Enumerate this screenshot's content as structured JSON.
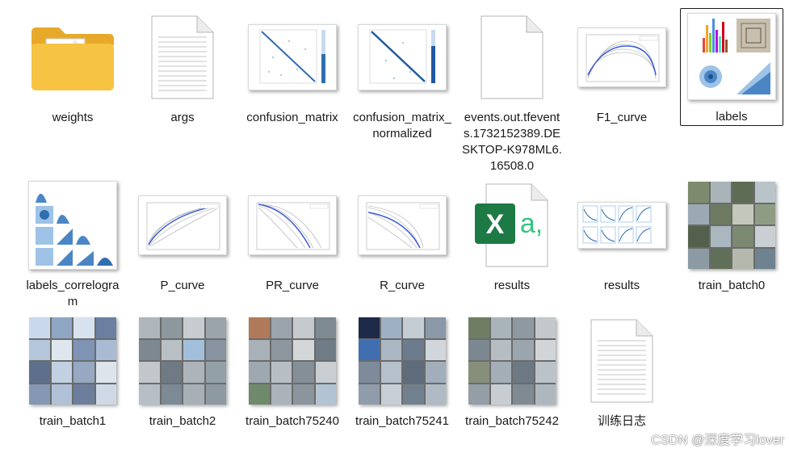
{
  "files": [
    {
      "name": "weights",
      "icon": "folder-icon"
    },
    {
      "name": "args",
      "icon": "text-file-icon"
    },
    {
      "name": "confusion_matrix",
      "icon": "image-thumbnail-icon"
    },
    {
      "name": "confusion_matrix_normalized",
      "icon": "image-thumbnail-icon"
    },
    {
      "name": "events.out.tfevents.1732152389.DESKTOP-K978ML6.16508.0",
      "icon": "blank-file-icon"
    },
    {
      "name": "F1_curve",
      "icon": "image-thumbnail-icon"
    },
    {
      "name": "labels",
      "icon": "image-thumbnail-icon",
      "selected": true
    },
    {
      "name": "labels_correlogram",
      "icon": "image-thumbnail-icon"
    },
    {
      "name": "P_curve",
      "icon": "image-thumbnail-icon"
    },
    {
      "name": "PR_curve",
      "icon": "image-thumbnail-icon"
    },
    {
      "name": "R_curve",
      "icon": "image-thumbnail-icon"
    },
    {
      "name": "results",
      "icon": "excel-file-icon"
    },
    {
      "name": "results",
      "icon": "image-thumbnail-icon"
    },
    {
      "name": "train_batch0",
      "icon": "image-thumbnail-icon"
    },
    {
      "name": "train_batch1",
      "icon": "image-thumbnail-icon"
    },
    {
      "name": "train_batch2",
      "icon": "image-thumbnail-icon"
    },
    {
      "name": "train_batch75240",
      "icon": "image-thumbnail-icon"
    },
    {
      "name": "train_batch75241",
      "icon": "image-thumbnail-icon"
    },
    {
      "name": "train_batch75242",
      "icon": "image-thumbnail-icon"
    },
    {
      "name": "训练日志",
      "icon": "text-file-icon"
    }
  ],
  "watermark": "CSDN @深度学习lover",
  "colors": {
    "folder": "#f6c342",
    "excel": "#1d7a45",
    "excel_text": "#33c481",
    "plot_line": "#3b5bdb",
    "matrix": "#2f6fb0"
  }
}
